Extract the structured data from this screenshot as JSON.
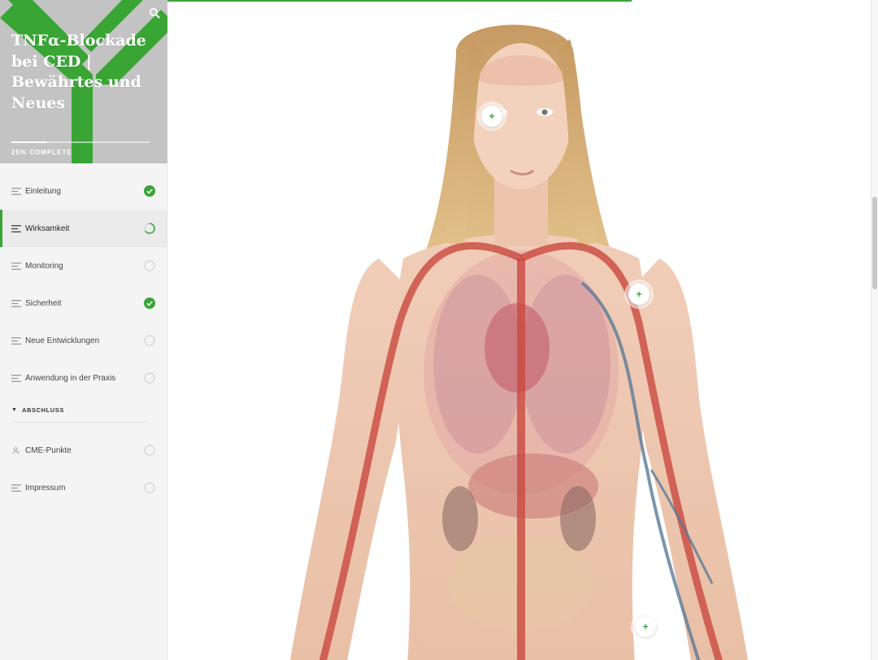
{
  "course": {
    "title": "TNFα-Blockade bei CED | Bewährtes und Neues",
    "progress_label": "25% COMPLETE",
    "progress_fraction": 0.25
  },
  "top_progress_fraction": 0.66,
  "colors": {
    "accent": "#3aa535",
    "hero_bg": "#c3c3c3",
    "sidebar_bg": "#f4f4f4"
  },
  "nav": {
    "items": [
      {
        "label": "Einleitung",
        "status": "complete",
        "icon": "lines-icon"
      },
      {
        "label": "Wirksamkeit",
        "status": "in-progress",
        "icon": "lines-icon"
      },
      {
        "label": "Monitoring",
        "status": "not-started",
        "icon": "lines-icon"
      },
      {
        "label": "Sicherheit",
        "status": "complete",
        "icon": "lines-icon"
      },
      {
        "label": "Neue Entwicklungen",
        "status": "not-started",
        "icon": "lines-icon"
      },
      {
        "label": "Anwendung in der Praxis",
        "status": "not-started",
        "icon": "lines-icon"
      }
    ],
    "section": {
      "label": "ABSCHLUSS",
      "items": [
        {
          "label": "CME-Punkte",
          "status": "not-started",
          "icon": "user-icon"
        },
        {
          "label": "Impressum",
          "status": "not-started",
          "icon": "lines-icon"
        }
      ]
    }
  },
  "hotspots": [
    {
      "label": "+"
    },
    {
      "label": "+"
    },
    {
      "label": "+"
    }
  ]
}
